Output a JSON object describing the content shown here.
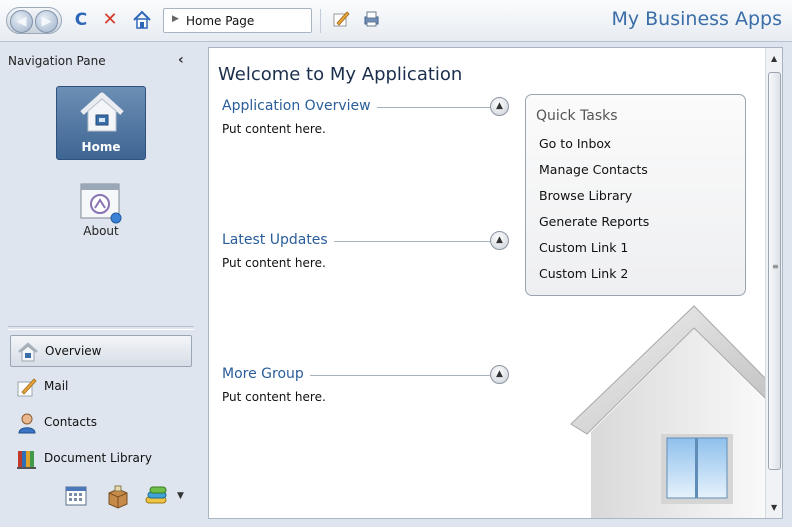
{
  "toolbar": {
    "back_arrow": "◀",
    "forward_arrow": "▶",
    "refresh_glyph": "C",
    "stop_glyph": "✕",
    "address_arrow": "▶",
    "address_value": "Home Page",
    "app_title": "My Business Apps"
  },
  "nav": {
    "header": "Navigation Pane",
    "collapse_glyph": "‹",
    "big_items": [
      {
        "label": "Home",
        "icon": "home-icon"
      },
      {
        "label": "About",
        "icon": "about-window-icon"
      }
    ],
    "list_items": [
      {
        "label": "Overview",
        "icon": "house-small-icon"
      },
      {
        "label": "Mail",
        "icon": "pen-paper-icon"
      },
      {
        "label": "Contacts",
        "icon": "person-icon"
      },
      {
        "label": "Document Library",
        "icon": "books-icon"
      }
    ],
    "bottom_icons": [
      "calendar-icon",
      "package-icon",
      "stack-icon"
    ],
    "more_glyph": "▼"
  },
  "content": {
    "title": "Welcome to My Application",
    "sections": [
      {
        "title": "Application Overview",
        "body": "Put content here."
      },
      {
        "title": "Latest Updates",
        "body": "Put content here."
      },
      {
        "title": "More Group",
        "body": "Put content here."
      }
    ],
    "collapse_glyph": "▲",
    "quick_tasks": {
      "title": "Quick Tasks",
      "links": [
        "Go to Inbox",
        "Manage Contacts",
        "Browse Library",
        "Generate Reports",
        "Custom Link 1",
        "Custom Link 2"
      ]
    }
  },
  "scrollbar": {
    "up": "▲",
    "down": "▼",
    "grip": "≡"
  },
  "colors": {
    "accent": "#3a6ea8",
    "selected_nav": "#3e6593",
    "section_title": "#2a5d99"
  }
}
